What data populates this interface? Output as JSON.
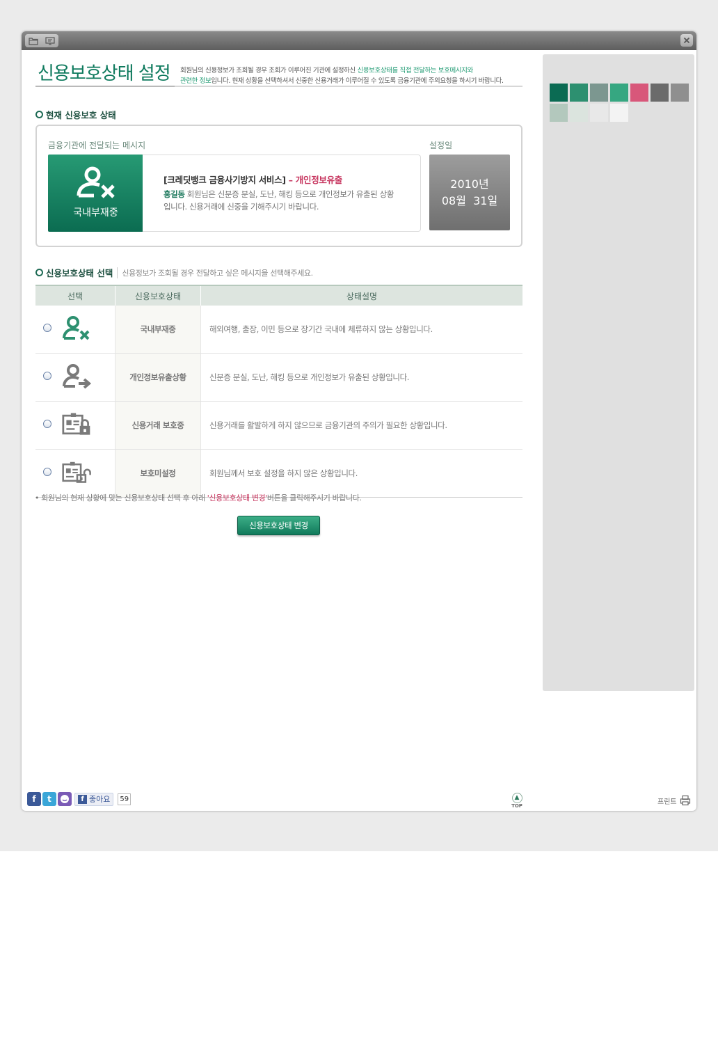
{
  "page": {
    "title": "신용보호상태 설정",
    "intro_part1": "회원님의 신용정보가 조회될 경우 조회가 이루어진 기관에 설정하신 ",
    "intro_hl1": "신용보호상태를 직접 전달하는 보호메시지와",
    "intro_hl2": "관련한 정보",
    "intro_part2": "입니다. 현재 상황을 선택하셔서 신중한 신용거래가 이루어질 수 있도록 금융기관에 주의요청을 하시기 바랍니다."
  },
  "current": {
    "heading": "현재 신용보호 상태",
    "message_label": "금융기관에 전달되는 메시지",
    "date_label": "설정일",
    "status_caption": "국내부재중",
    "message_title_black": "[크레딧뱅크 금융사기방지 서비스]",
    "message_title_red": " – 개인정보유출",
    "message_name": "홍길동",
    "message_text": " 회원님은 신분증 분실, 도난, 해킹 등으로 개인정보가 유출된 상황입니다. 신용거래에 신중을 기해주시기 바랍니다.",
    "date_line1": "2010년",
    "date_line2": "08월  31일"
  },
  "selection": {
    "heading": "신용보호상태 선택",
    "subtext": "신용정보가 조회될 경우 전달하고 싶은 메시지을 선택해주세요.",
    "columns": [
      "선택",
      "신용보호상태",
      "상태설명"
    ],
    "rows": [
      {
        "name": "국내부재중",
        "desc": "해외여행, 출장, 이민 등으로 장기간 국내에 체류하지 않는 상황입니다."
      },
      {
        "name": "개인정보유출상황",
        "desc": "신분증 분실, 도난, 해킹 등으로 개인정보가 유출된 상황입니다."
      },
      {
        "name": "신용거래 보호중",
        "desc": "신용거래를 활발하게 하지 않으므로 금융기관의 주의가 필요한 상황입니다."
      },
      {
        "name": "보호미설정",
        "desc": "회원님께서 보호 설정을 하지 않은 상황입니다."
      }
    ],
    "notice_part1": "• 회원님의 현재 상황에 맞는 신용보호상태 선택 후 아래 ",
    "notice_red": "'신용보호상태 변경'",
    "notice_part2": "버튼을 클릭해주시기 바랍니다.",
    "apply_button": "신용보호상태 변경"
  },
  "icons": {
    "status_card": "person-x-icon",
    "row_icons": [
      "person-x-icon",
      "person-arrow-icon",
      "id-card-lock-icon",
      "id-card-unlock-icon"
    ]
  },
  "swatch_colors": [
    "#0b6b53",
    "#2d9070",
    "#7c9790",
    "#36a781",
    "#d8577a",
    "#6b6b6b",
    "#8f8f8f",
    "#b3c8bd",
    "#dbe4de",
    "#e8e8e8",
    "#f3f3f3"
  ],
  "footer": {
    "social_f": "f",
    "social_t": "t",
    "like_label": "좋아요",
    "like_count": "59",
    "top_label": "TOP",
    "print_label": "프린트"
  }
}
